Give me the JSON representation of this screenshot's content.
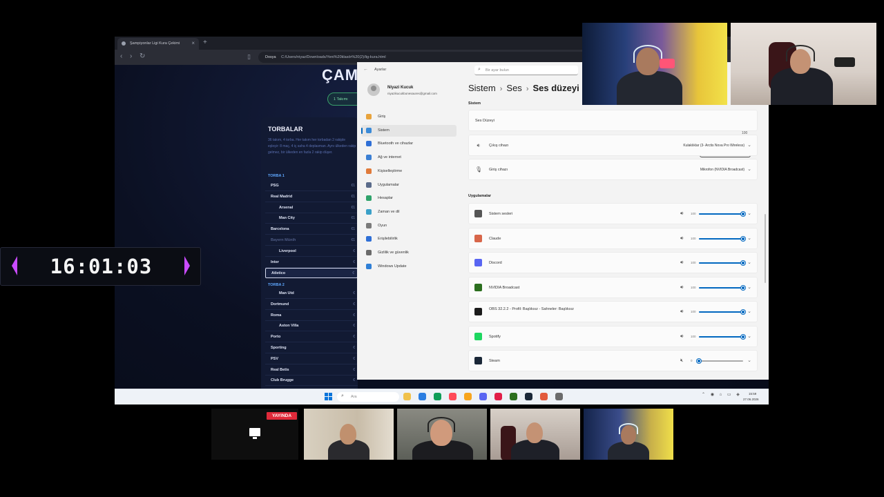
{
  "browser": {
    "tab_title": "Şampiyonlar Ligi Kura Çekimi",
    "address_label": "Dosya",
    "address_url": "C:/Users/niyaz/Downloads/Yeni%20klasör%20(2)/lig-kura.html"
  },
  "webpage": {
    "heading": "ÇAM",
    "pill_label": "1 Takımı",
    "panel_title": "TORBALAR",
    "panel_desc": "36 takım, 4 torba. Her takım her torbadan 2 rakiple eşleşir: 8 maç, 4 iç saha 4 deplasman. Aynı ülkeden rakip gelmez, bir ülkeden en fazla 2 rakip düşer.",
    "pot1_label": "TORBA 1",
    "pot1_teams": [
      {
        "name": "PSG",
        "coef": "€1"
      },
      {
        "name": "Real Madrid",
        "coef": "€1"
      },
      {
        "name": "Arsenal",
        "coef": "€1"
      },
      {
        "name": "Man City",
        "coef": "€1"
      },
      {
        "name": "Barcelona",
        "coef": "€1"
      },
      {
        "name": "Bayern Münih",
        "coef": "€1"
      },
      {
        "name": "Liverpool",
        "coef": "€"
      },
      {
        "name": "Inter",
        "coef": "€"
      },
      {
        "name": "Atletico",
        "coef": "€"
      }
    ],
    "pot2_label": "TORBA 2",
    "pot2_teams": [
      {
        "name": "Man Utd",
        "coef": "€"
      },
      {
        "name": "Dortmund",
        "coef": "€"
      },
      {
        "name": "Roma",
        "coef": "€"
      },
      {
        "name": "Aston Villa",
        "coef": "€"
      },
      {
        "name": "Porto",
        "coef": "€"
      },
      {
        "name": "Sporting",
        "coef": "€"
      },
      {
        "name": "PSV",
        "coef": "€"
      },
      {
        "name": "Real Betis",
        "coef": "€"
      },
      {
        "name": "Club Brugge",
        "coef": "€"
      }
    ]
  },
  "settings": {
    "window_title": "Ayarlar",
    "search_placeholder": "Bir ayar bulun",
    "profile_name": "Niyazi Kucuk",
    "profile_email": "niyazikucukbonesaures@gmail.com",
    "nav": [
      {
        "label": "Giriş",
        "color": "#e8a33c"
      },
      {
        "label": "Sistem",
        "color": "#3a8ad8"
      },
      {
        "label": "Bluetooth ve cihazlar",
        "color": "#2f6fd6"
      },
      {
        "label": "Ağ ve internet",
        "color": "#3b7fd4"
      },
      {
        "label": "Kişiselleştirme",
        "color": "#e07a3a"
      },
      {
        "label": "Uygulamalar",
        "color": "#5a6b8a"
      },
      {
        "label": "Hesaplar",
        "color": "#2fa36b"
      },
      {
        "label": "Zaman ve dil",
        "color": "#3aa0c8"
      },
      {
        "label": "Oyun",
        "color": "#7a7a7a"
      },
      {
        "label": "Erişilebilirlik",
        "color": "#2f6fd6"
      },
      {
        "label": "Gizlilik ve güvenlik",
        "color": "#6a6a6a"
      },
      {
        "label": "Windows Update",
        "color": "#2f7fd6"
      }
    ],
    "breadcrumb": [
      "Sistem",
      "Ses",
      "Ses düzeyi"
    ],
    "section_system": "Sistem",
    "master_label": "Ses Düzeyi",
    "master_value": "100",
    "master_tooltip": "100",
    "output_label": "Çıkış cihazı",
    "output_value": "Kulaklıklar (3- Arctis Nova Pro Wireless)",
    "input_label": "Giriş cihazı",
    "input_value": "Mikrofon (NVIDIA Broadcast)",
    "section_apps": "Uygulamalar",
    "apps": [
      {
        "name": "Sistem sesleri",
        "volume": 100,
        "icon": "headphones-icon",
        "color": "#555555"
      },
      {
        "name": "Claude",
        "volume": 100,
        "icon": "claude-icon",
        "color": "#d8664a"
      },
      {
        "name": "Discord",
        "volume": 100,
        "icon": "discord-icon",
        "color": "#5865f2"
      },
      {
        "name": "NVIDIA Broadcast",
        "volume": 100,
        "icon": "nvidia-icon",
        "color": "#2b6e1e"
      },
      {
        "name": "OBS 32.2.2 - Profil: Başlıksız - Sahneler: Başlıksız",
        "volume": 100,
        "icon": "obs-icon",
        "color": "#1b1b1b"
      },
      {
        "name": "Spotify",
        "volume": 100,
        "icon": "spotify-icon",
        "color": "#1ed760"
      },
      {
        "name": "Steam",
        "volume": 0,
        "icon": "steam-icon",
        "color": "#1b2838"
      }
    ]
  },
  "taskbar": {
    "search_placeholder": "Ara",
    "time": "15:59",
    "date": "27.06.2026",
    "apps": [
      "#f0c14b",
      "#2a7de1",
      "#0f9d58",
      "#ff4a5a",
      "#f7a51e",
      "#5865f2",
      "#e11d48",
      "#2b6e1e",
      "#1b2838",
      "#e25a3c",
      "#6b6b6b"
    ]
  },
  "overlay": {
    "timer": "16:01:03",
    "live_badge": "YAYINDA"
  }
}
